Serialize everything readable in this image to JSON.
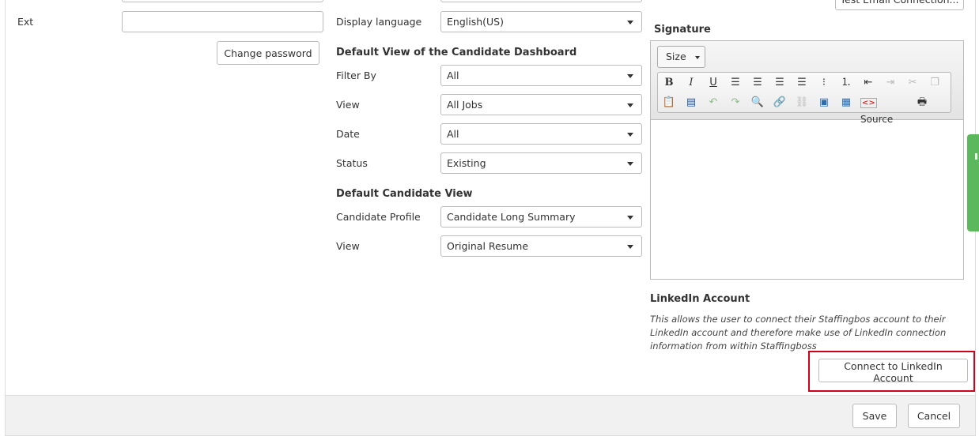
{
  "top_button": {
    "label": "Test Email Connection..."
  },
  "left": {
    "ext_label": "Ext",
    "ext_value": "",
    "change_password_label": "Change password"
  },
  "middle": {
    "display_language_label": "Display language",
    "display_language_value": "English(US)",
    "dashboard_title": "Default View of the Candidate Dashboard",
    "filter_by_label": "Filter By",
    "filter_by_value": "All",
    "view_label": "View",
    "view_value": "All Jobs",
    "date_label": "Date",
    "date_value": "All",
    "status_label": "Status",
    "status_value": "Existing",
    "candidate_view_title": "Default Candidate View",
    "candidate_profile_label": "Candidate Profile",
    "candidate_profile_value": "Candidate Long Summary",
    "view2_label": "View",
    "view2_value": "Original Resume"
  },
  "signature": {
    "title": "Signature",
    "size_label": "Size",
    "source_label": "Source"
  },
  "linkedin": {
    "title": "LinkedIn Account",
    "description": "This allows the user to connect their Staffingbos account to their LinkedIn account and therefore make use of LinkedIn connection information from within Staffingboss",
    "connect_label": "Connect to LinkedIn Account"
  },
  "footer": {
    "save_label": "Save",
    "cancel_label": "Cancel"
  },
  "colors": {
    "highlight": "#d0021b",
    "side_tab": "#5cb85c"
  }
}
